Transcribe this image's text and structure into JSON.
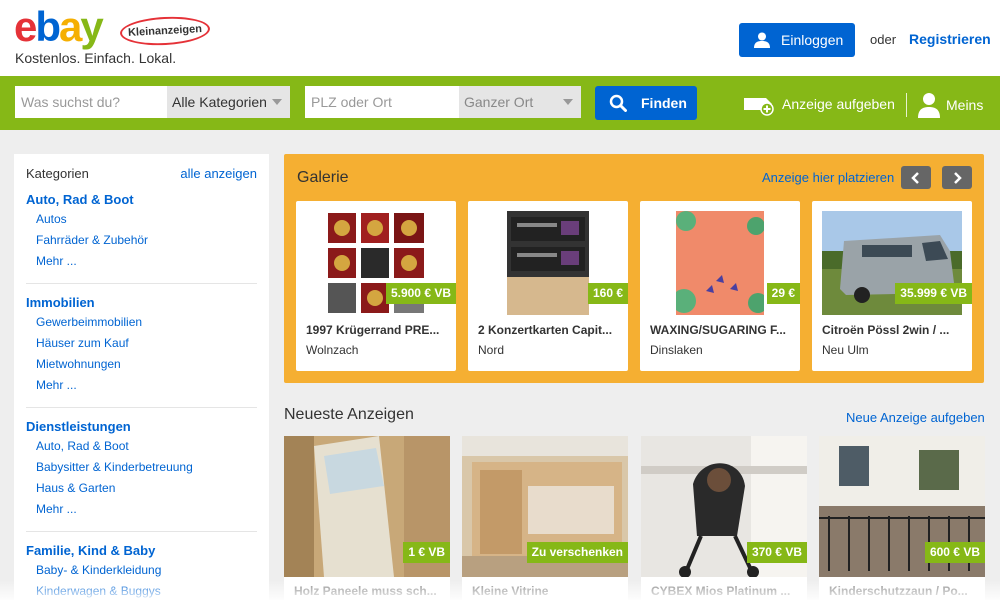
{
  "header": {
    "logo": {
      "e": "e",
      "b": "b",
      "a": "a",
      "y": "y"
    },
    "badge": "Kleinanzeigen",
    "tagline": "Kostenlos. Einfach. Lokal.",
    "login_label": "Einloggen",
    "or_text": "oder",
    "register_label": "Registrieren"
  },
  "search": {
    "query_placeholder": "Was suchst du?",
    "category_value": "Alle Kategorien",
    "location_placeholder": "PLZ oder Ort",
    "radius_value": "Ganzer Ort",
    "find_label": "Finden",
    "post_ad_label": "Anzeige aufgeben",
    "meins_label": "Meins"
  },
  "sidebar": {
    "heading": "Kategorien",
    "all_link": "alle anzeigen",
    "groups": [
      {
        "title": "Auto, Rad & Boot",
        "items": [
          "Autos",
          "Fahrräder & Zubehör",
          "Mehr ..."
        ]
      },
      {
        "title": "Immobilien",
        "items": [
          "Gewerbeimmobilien",
          "Häuser zum Kauf",
          "Mietwohnungen",
          "Mehr ..."
        ]
      },
      {
        "title": "Dienstleistungen",
        "items": [
          "Auto, Rad & Boot",
          "Babysitter & Kinderbetreuung",
          "Haus & Garten",
          "Mehr ..."
        ]
      },
      {
        "title": "Familie, Kind & Baby",
        "items": [
          "Baby- & Kinderkleidung",
          "Kinderwagen & Buggys"
        ]
      }
    ]
  },
  "gallery": {
    "title": "Galerie",
    "place_link": "Anzeige hier platzieren",
    "cards": [
      {
        "name": "1997 Krügerrand PRE...",
        "price": "5.900 € VB",
        "location": "Wolnzach"
      },
      {
        "name": "2 Konzertkarten Capit...",
        "price": "160 €",
        "location": "Nord"
      },
      {
        "name": "WAXING/SUGARING F...",
        "price": "29 €",
        "location": "Dinslaken"
      },
      {
        "name": "Citroën Pössl 2win / ...",
        "price": "35.999 € VB",
        "location": "Neu Ulm"
      }
    ]
  },
  "newest": {
    "title": "Neueste Anzeigen",
    "post_link": "Neue Anzeige aufgeben",
    "cards": [
      {
        "name": "Holz Paneele muss sch...",
        "price": "1 € VB"
      },
      {
        "name": "Kleine Vitrine",
        "price": "Zu verschenken"
      },
      {
        "name": "CYBEX Mios Platinum ...",
        "price": "370 € VB"
      },
      {
        "name": "Kinderschutzzaun / Po...",
        "price": "600 € VB"
      }
    ]
  },
  "colors": {
    "brand_green": "#86b817",
    "brand_blue": "#0064d2",
    "gallery_orange": "#f5af32"
  }
}
